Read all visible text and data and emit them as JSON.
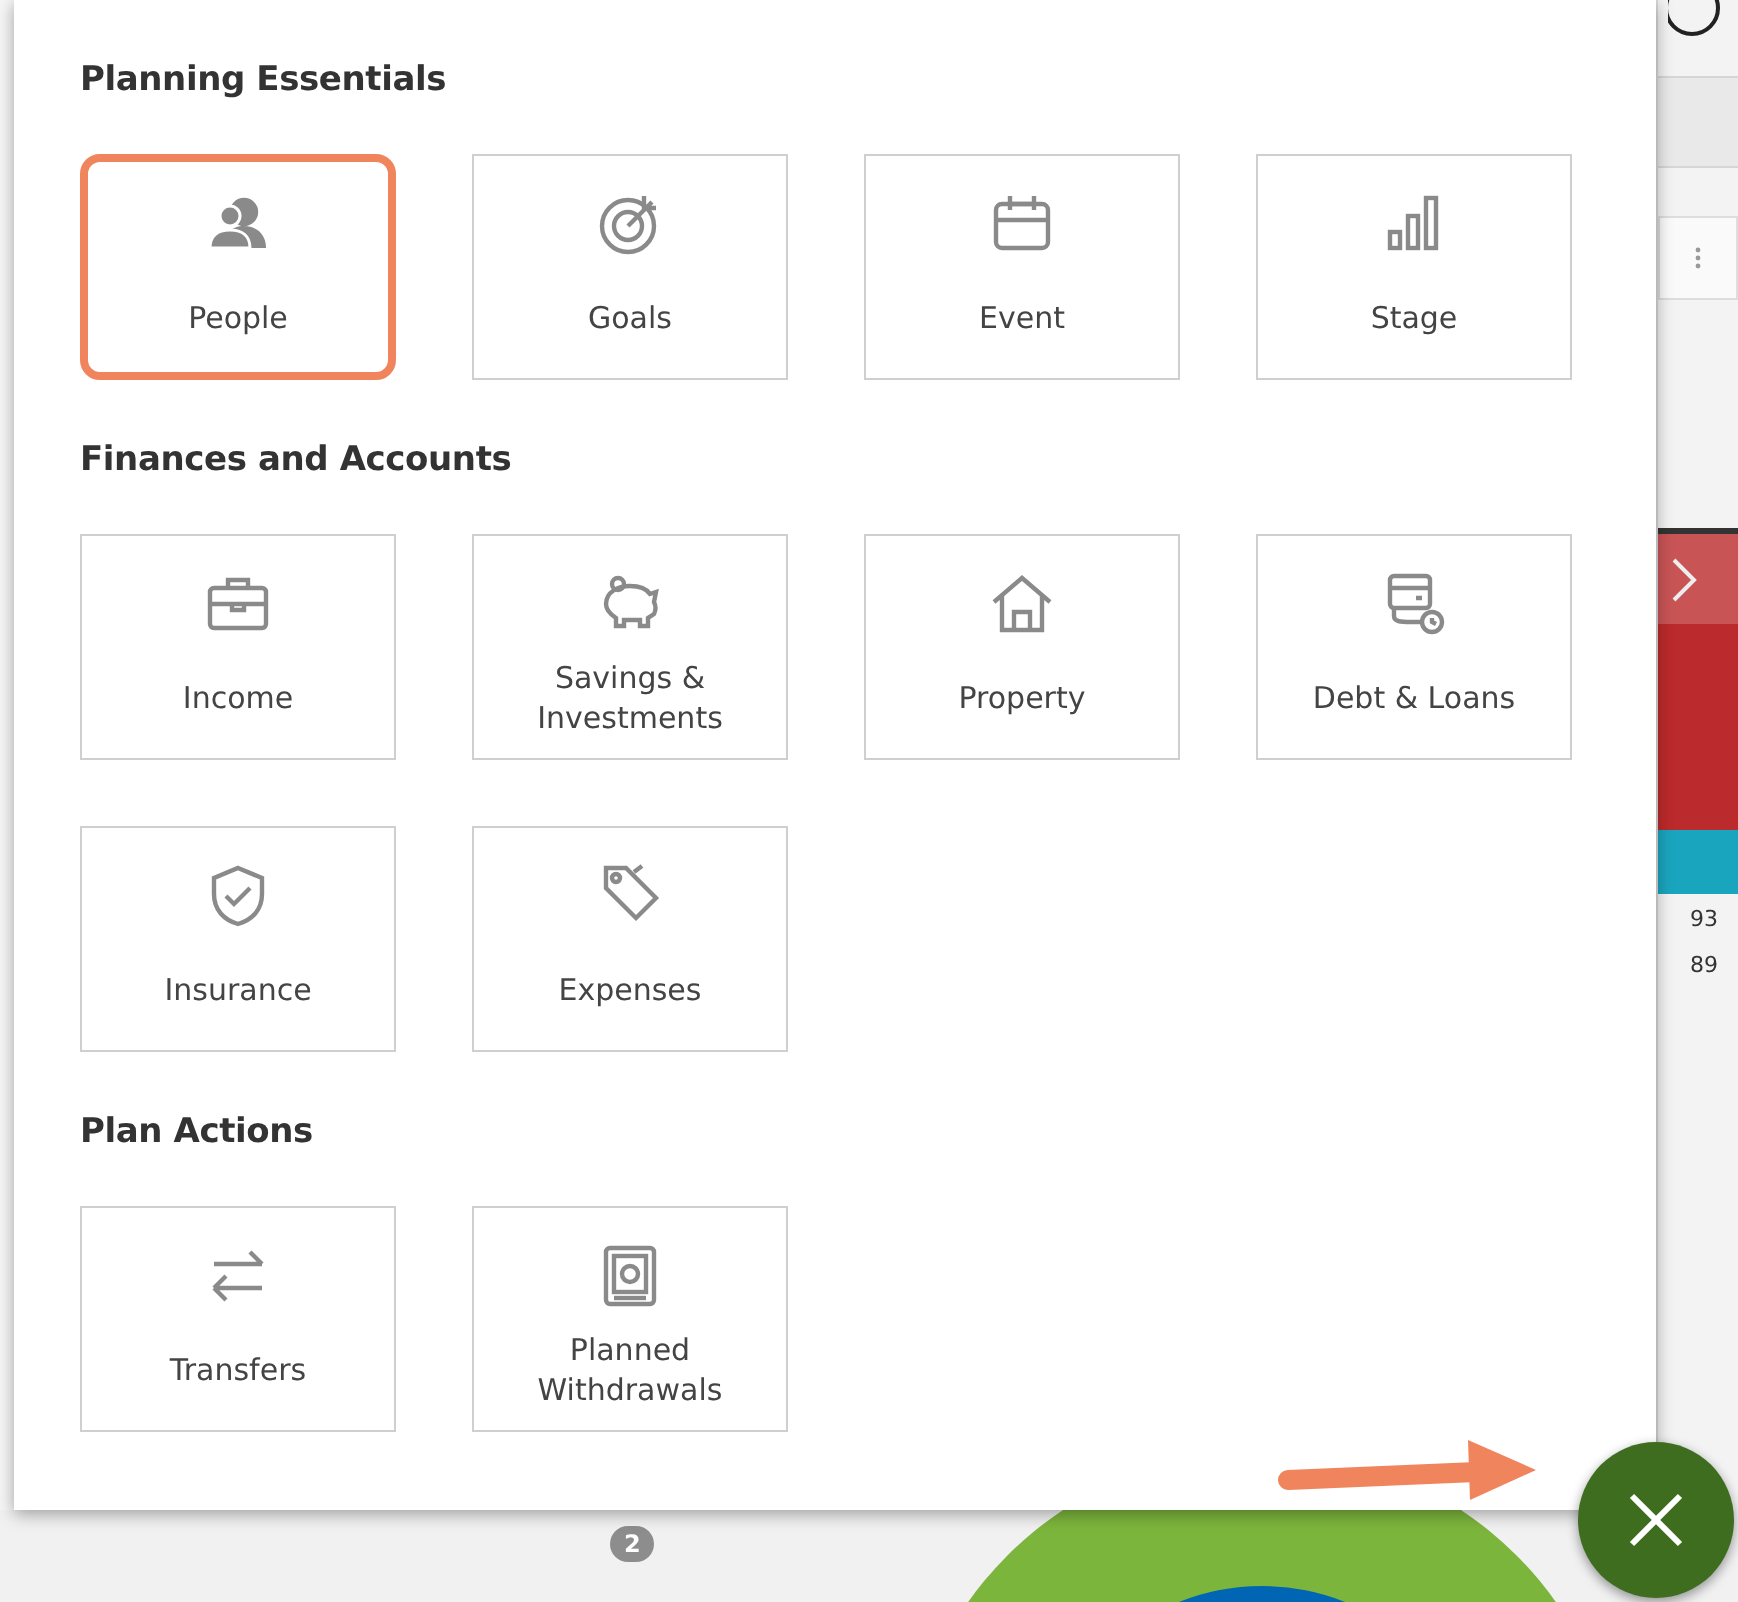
{
  "menu": {
    "sections": [
      {
        "title": "Planning Essentials",
        "tiles": [
          {
            "label": "People",
            "selected": true
          },
          {
            "label": "Goals",
            "selected": false
          },
          {
            "label": "Event",
            "selected": false
          },
          {
            "label": "Stage",
            "selected": false
          }
        ]
      },
      {
        "title": "Finances and Accounts",
        "tiles": [
          {
            "label": "Income",
            "selected": false
          },
          {
            "label": "Savings & Investments",
            "selected": false
          },
          {
            "label": "Property",
            "selected": false
          },
          {
            "label": "Debt & Loans",
            "selected": false
          },
          {
            "label": "Insurance",
            "selected": false
          },
          {
            "label": "Expenses",
            "selected": false
          }
        ]
      },
      {
        "title": "Plan Actions",
        "tiles": [
          {
            "label": "Transfers",
            "selected": false
          },
          {
            "label": "Planned Withdrawals",
            "selected": false
          }
        ]
      }
    ]
  },
  "background": {
    "values": [
      "93",
      "89"
    ],
    "badge": "2"
  }
}
